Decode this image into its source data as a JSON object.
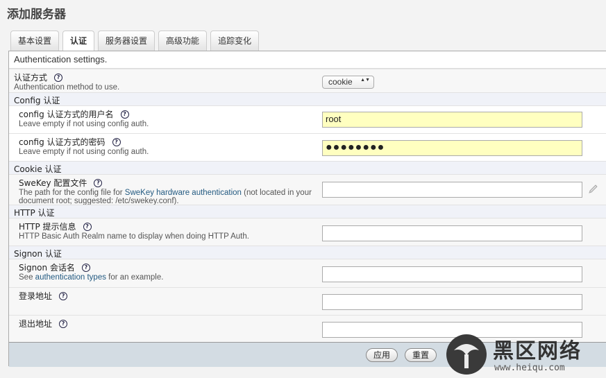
{
  "page": {
    "title": "添加服务器"
  },
  "tabs": [
    {
      "label": "基本设置",
      "active": false
    },
    {
      "label": "认证",
      "active": true
    },
    {
      "label": "服务器设置",
      "active": false
    },
    {
      "label": "高级功能",
      "active": false
    },
    {
      "label": "追踪变化",
      "active": false
    }
  ],
  "panel": {
    "description": "Authentication settings.",
    "auth_type": {
      "title": "认证方式",
      "desc": "Authentication method to use.",
      "value": "cookie"
    },
    "groups": {
      "config": "Config 认证",
      "cookie": "Cookie 认证",
      "http": "HTTP 认证",
      "signon": "Signon 认证"
    },
    "config_user": {
      "title": "config 认证方式的用户名",
      "desc": "Leave empty if not using config auth.",
      "value": "root"
    },
    "config_password": {
      "title": "config 认证方式的密码",
      "desc": "Leave empty if not using config auth.",
      "value": "●●●●●●●●"
    },
    "swekey": {
      "title": "SweKey 配置文件",
      "desc_pre": "The path for the config file for ",
      "desc_link": "SweKey hardware authentication",
      "desc_post": " (not located in your document root; suggested: /etc/swekey.conf).",
      "value": ""
    },
    "http_realm": {
      "title": "HTTP 提示信息",
      "desc": "HTTP Basic Auth Realm name to display when doing HTTP Auth.",
      "value": ""
    },
    "signon_session": {
      "title": "Signon 会话名",
      "desc_pre": "See ",
      "desc_link": "authentication types",
      "desc_post": " for an example.",
      "value": ""
    },
    "login_url": {
      "title": "登录地址",
      "value": ""
    },
    "logout_url": {
      "title": "退出地址",
      "value": ""
    },
    "help_glyph": "?",
    "select_arrows": "▲▼"
  },
  "buttons": {
    "apply": "应用",
    "reset": "重置"
  },
  "watermark": {
    "text": "黑区网络",
    "url": "www.heiqu.com"
  }
}
